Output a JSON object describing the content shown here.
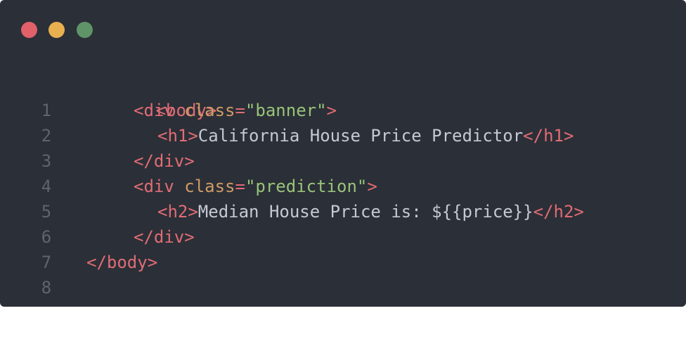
{
  "window": {
    "controls": [
      {
        "name": "close",
        "color": "#e0616a"
      },
      {
        "name": "minimize",
        "color": "#e9b04f"
      },
      {
        "name": "maximize",
        "color": "#5f9469"
      }
    ]
  },
  "code": {
    "lines": [
      {
        "number": "1",
        "open": "<body>"
      },
      {
        "number": "2",
        "open": "<div ",
        "attr": "class",
        "eq": "=",
        "value": "\"banner\"",
        "close": ">"
      },
      {
        "number": "3",
        "open": "<h1>",
        "text": "California House Price Predictor",
        "close": "</h1>"
      },
      {
        "number": "4",
        "open": "</div>"
      },
      {
        "number": "5",
        "open": "<div ",
        "attr": "class",
        "eq": "=",
        "value": "\"prediction\"",
        "close": ">"
      },
      {
        "number": "6",
        "open": "<h2>",
        "text": "Median House Price is: ${{price}}",
        "close": "</h2>"
      },
      {
        "number": "7",
        "open": "</div>"
      },
      {
        "number": "8",
        "open": "</body>"
      }
    ]
  },
  "colors": {
    "background": "#2b2f37",
    "tag": "#e06c75",
    "attribute": "#d19a66",
    "string": "#98c379",
    "text": "#c4c9d4",
    "line_number": "#5e6470"
  }
}
